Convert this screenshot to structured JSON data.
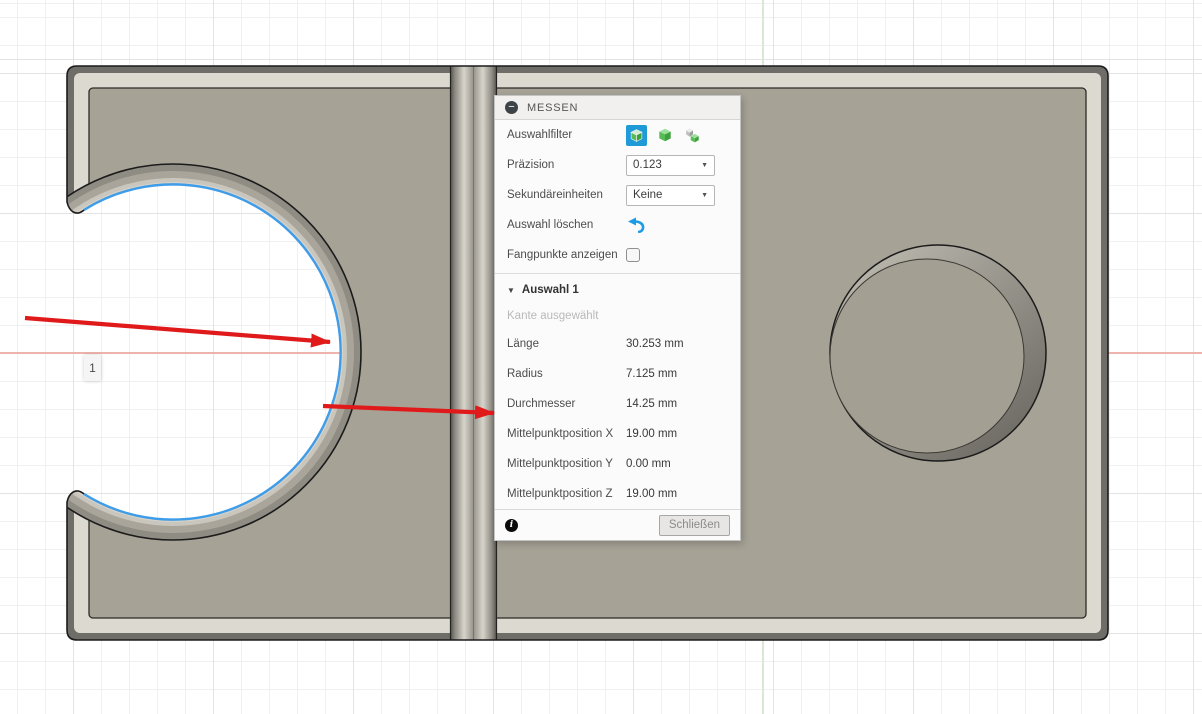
{
  "viewport": {
    "selection_marker": "1"
  },
  "panel": {
    "title": "MESSEN",
    "collapse_icon": "minus",
    "selection_filter_label": "Auswahlfilter",
    "precision_label": "Präzision",
    "precision_value": "0.123",
    "secondary_units_label": "Sekundäreinheiten",
    "secondary_units_value": "Keine",
    "clear_selection_label": "Auswahl löschen",
    "show_snap_points_label": "Fangpunkte anzeigen",
    "snap_points_checked": false,
    "selection_section": {
      "title": "Auswahl 1",
      "status": "Kante ausgewählt",
      "measurements": [
        {
          "label": "Länge",
          "value": "30.253 mm"
        },
        {
          "label": "Radius",
          "value": "7.125 mm"
        },
        {
          "label": "Durchmesser",
          "value": "14.25 mm"
        },
        {
          "label": "Mittelpunktposition X",
          "value": "19.00 mm"
        },
        {
          "label": "Mittelpunktposition Y",
          "value": "0.00 mm"
        },
        {
          "label": "Mittelpunktposition Z",
          "value": "19.00 mm"
        }
      ]
    },
    "close_label": "Schließen"
  },
  "colors": {
    "selection_edge_blue": "#3f9ce8",
    "accent_blue": "#1e9bd7",
    "annotation_arrow_red": "#e01a1a",
    "part_face": "#a6a296",
    "axis_x_red": "#eeb3ad",
    "axis_y_green": "#d9e7d4"
  }
}
